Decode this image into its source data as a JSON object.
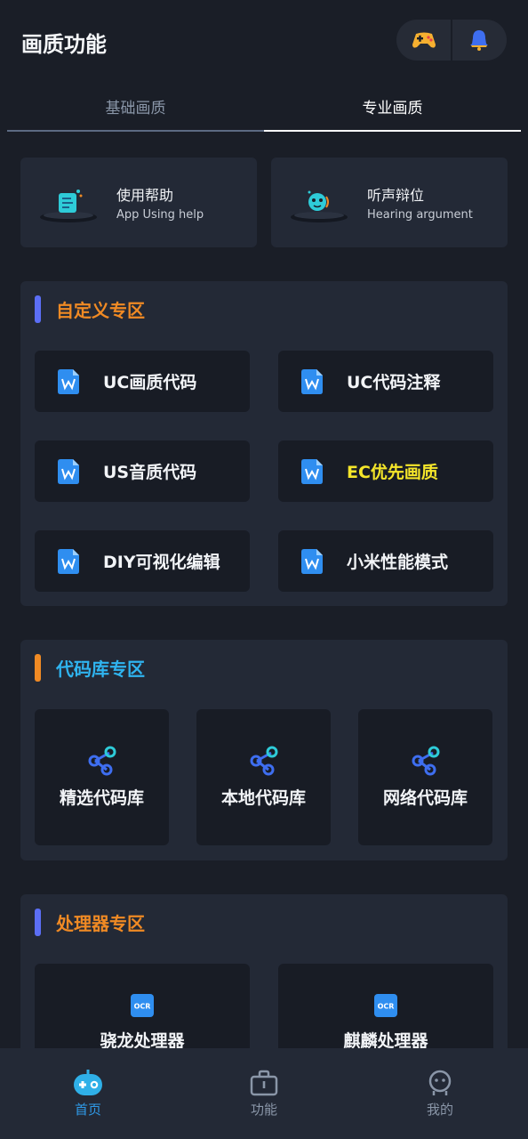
{
  "header": {
    "title": "画质功能",
    "icons": [
      "gamepad-icon",
      "bell-icon"
    ]
  },
  "tabs": [
    {
      "label": "基础画质",
      "active": false
    },
    {
      "label": "专业画质",
      "active": true
    }
  ],
  "help_cards": [
    {
      "title": "使用帮助",
      "subtitle": "App Using help",
      "icon": "help-book-icon"
    },
    {
      "title": "听声辩位",
      "subtitle": "Hearing argument",
      "icon": "hearing-icon"
    }
  ],
  "sections": {
    "custom": {
      "title": "自定义专区",
      "title_color": "#f08a24",
      "bar_color": "#5b6ef5",
      "items": [
        {
          "label": "UC画质代码",
          "color": "#f2f4f7"
        },
        {
          "label": "UC代码注释",
          "color": "#f2f4f7"
        },
        {
          "label": "US音质代码",
          "color": "#f2f4f7"
        },
        {
          "label": "EC优先画质",
          "color": "#f5e62a"
        },
        {
          "label": "DIY可视化编辑",
          "color": "#f2f4f7"
        },
        {
          "label": "小米性能模式",
          "color": "#f2f4f7"
        }
      ]
    },
    "library": {
      "title": "代码库专区",
      "title_color": "#2fb4f0",
      "bar_color": "#f08a24",
      "items": [
        {
          "label": "精选代码库"
        },
        {
          "label": "本地代码库"
        },
        {
          "label": "网络代码库"
        }
      ]
    },
    "processor": {
      "title": "处理器专区",
      "title_color": "#f08a24",
      "bar_color": "#5b6ef5",
      "items": [
        {
          "label": "骁龙处理器",
          "badge": "OCR"
        },
        {
          "label": "麒麟处理器",
          "badge": "OCR"
        }
      ]
    }
  },
  "bottom_nav": [
    {
      "label": "首页",
      "icon": "home-robot-icon",
      "active": true,
      "color": "#2f9ae8"
    },
    {
      "label": "功能",
      "icon": "toolbox-icon",
      "active": false,
      "color": "#8a96a8"
    },
    {
      "label": "我的",
      "icon": "profile-icon",
      "active": false,
      "color": "#8a96a8"
    }
  ]
}
